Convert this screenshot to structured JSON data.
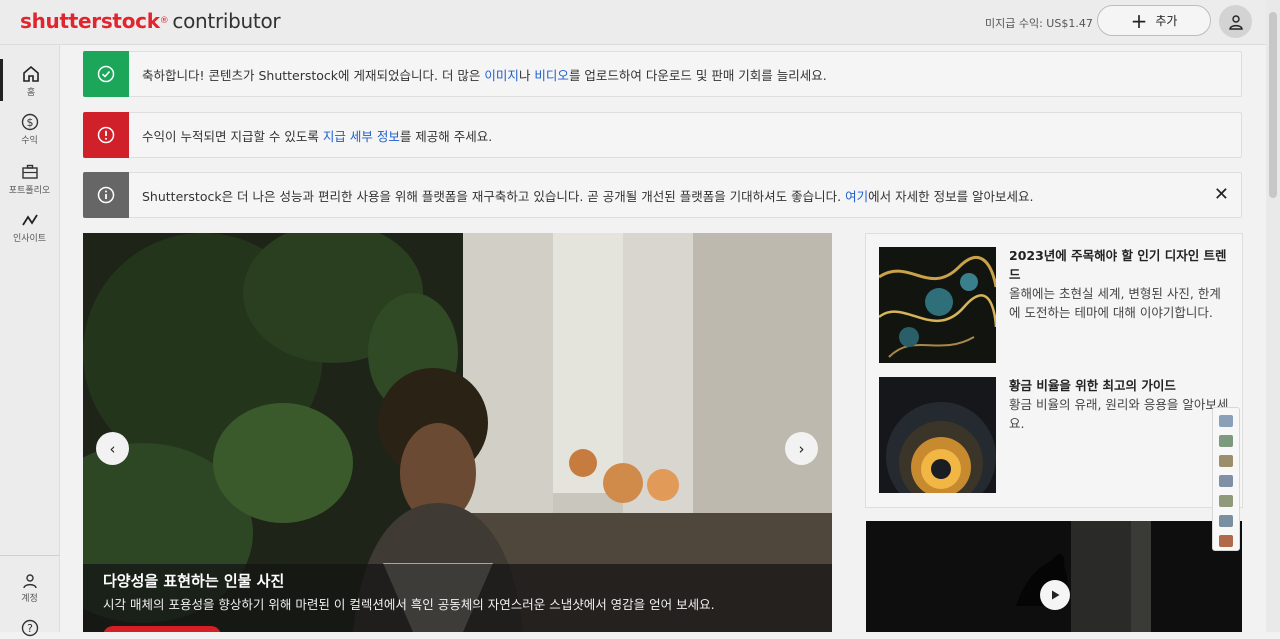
{
  "header": {
    "logo_brand": "shutterstock",
    "logo_reg": "®",
    "logo_sub": "contributor",
    "earnings": "미지급 수익: US$1.47",
    "add_label": "추가"
  },
  "sidebar": {
    "items": [
      {
        "label": "홈",
        "icon": "home-icon"
      },
      {
        "label": "수익",
        "icon": "dollar-icon"
      },
      {
        "label": "포트폴리오",
        "icon": "briefcase-icon"
      },
      {
        "label": "인사이트",
        "icon": "insights-icon"
      }
    ],
    "bottom": [
      {
        "label": "계정",
        "icon": "person-icon"
      },
      {
        "label": "",
        "icon": "help-icon"
      }
    ]
  },
  "notices": [
    {
      "type": "success",
      "color": "#1ba65a",
      "text_before": "축하합니다! 콘텐츠가 Shutterstock에 게재되었습니다. 더 많은 ",
      "link1": "이미지",
      "text_mid": "나 ",
      "link2": "비디오",
      "text_after": "를 업로드하여 다운로드 및 판매 기회를 늘리세요."
    },
    {
      "type": "error",
      "color": "#d0202a",
      "text_before": "수익이 누적되면 지급할 수 있도록 ",
      "link1": "지급 세부 정보",
      "text_after": "를 제공해 주세요."
    },
    {
      "type": "info",
      "color": "#666666",
      "text_before": "Shutterstock은 더 나은 성능과 편리한 사용을 위해 플랫폼을 재구축하고 있습니다. 곧 공개될 개선된 플랫폼을 기대하셔도 좋습니다. ",
      "link1": "여기",
      "text_after": "에서 자세한 정보를 알아보세요.",
      "close": "✕"
    }
  ],
  "hero": {
    "title": "다양성을 표현하는 인물 사진",
    "description": "시각 매체의 포용성을 향상하기 위해 마련된 이 컬렉션에서 흑인 공동체의 자연스러운 스냅샷에서 영감을 얻어 보세요.",
    "prev": "‹",
    "next": "›"
  },
  "articles": [
    {
      "title": "2023년에 주목해야 할 인기 디자인 트렌드",
      "description": "올해에는 초현실 세계, 변형된 사진, 한계에 도전하는 테마에 대해 이야기합니다."
    },
    {
      "title": "황금 비율을 위한 최고의 가이드",
      "description": "황금 비율의 유래, 원리와 응용을 알아보세요."
    }
  ],
  "colors": {
    "brand": "#e0252f",
    "link": "#1e5fcf"
  }
}
